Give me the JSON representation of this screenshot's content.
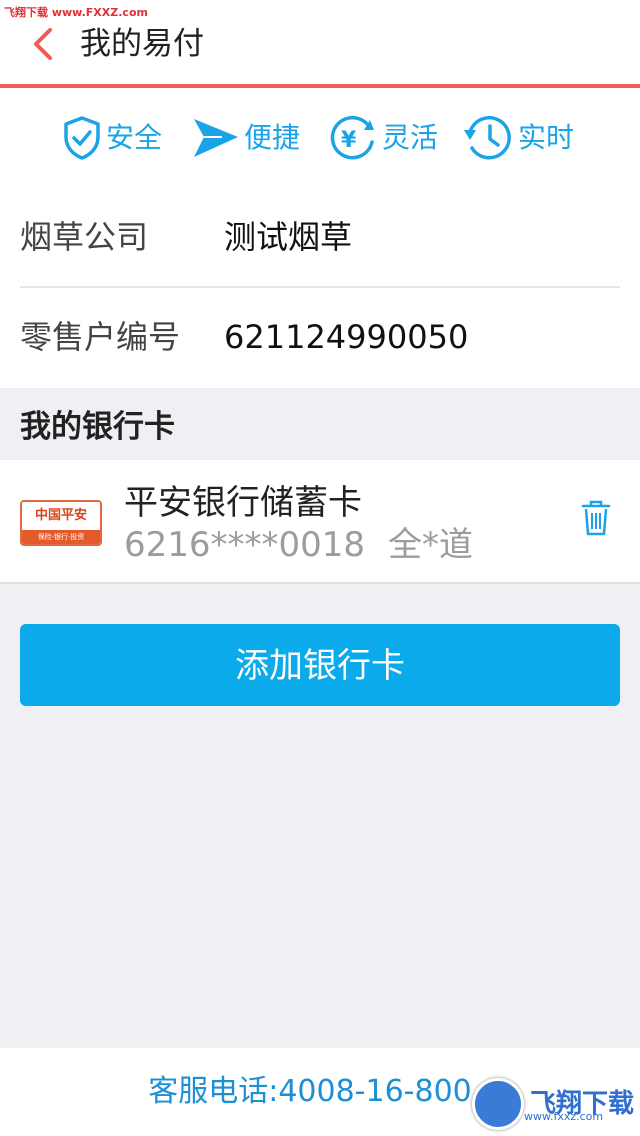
{
  "watermark": {
    "top_text": "飞翔下载 www.FXXZ.com",
    "corner_text": "飞翔下载",
    "corner_url": "www.fxxz.com"
  },
  "header": {
    "title": "我的易付",
    "back_icon": "chevron-left-icon",
    "border_color": "#f05a57"
  },
  "features": [
    {
      "icon": "shield-check-icon",
      "label": "安全"
    },
    {
      "icon": "paper-plane-icon",
      "label": "便捷"
    },
    {
      "icon": "yuan-refresh-icon",
      "label": "灵活"
    },
    {
      "icon": "clock-history-icon",
      "label": "实时"
    }
  ],
  "info": {
    "company_label": "烟草公司",
    "company_value": "测试烟草",
    "retailer_label": "零售户编号",
    "retailer_value": "621124990050"
  },
  "bank_section": {
    "title": "我的银行卡"
  },
  "card": {
    "logo_text": "中国平安",
    "logo_subtext": "保险·银行·投资",
    "name": "平安银行储蓄卡",
    "number": "6216****0018",
    "holder": "全*道",
    "delete_icon": "trash-icon"
  },
  "add_button": {
    "label": "添加银行卡",
    "color": "#0aaaeb"
  },
  "footer": {
    "phone": "客服电话:4008-16-800"
  },
  "colors": {
    "accent": "#1aa3e6",
    "background": "#efeff4"
  }
}
